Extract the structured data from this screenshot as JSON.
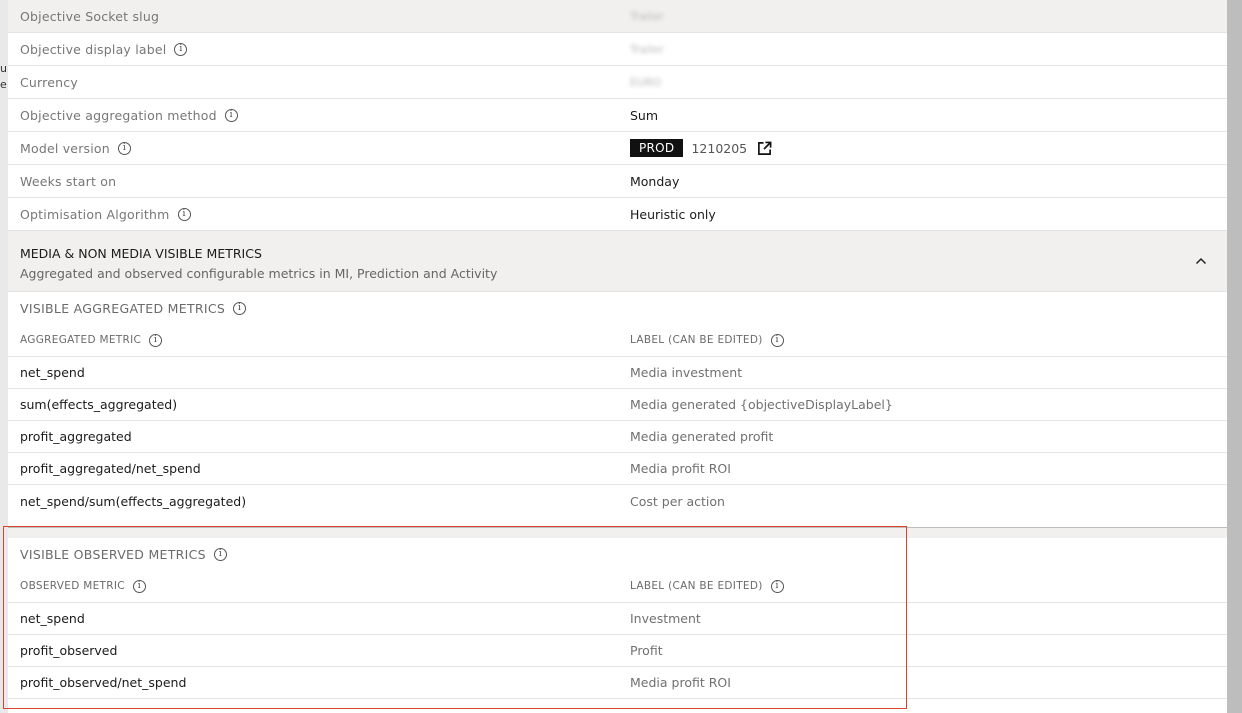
{
  "background_fragments": [
    "u",
    "e"
  ],
  "settings": [
    {
      "label": "Objective Socket slug",
      "info": false,
      "value": "Trailer",
      "blurred": true,
      "grey": true
    },
    {
      "label": "Objective display label",
      "info": true,
      "value": "Trailer",
      "blurred": true,
      "grey": false
    },
    {
      "label": "Currency",
      "info": false,
      "value": "EURO",
      "blurred": true,
      "grey": false
    },
    {
      "label": "Objective aggregation method",
      "info": true,
      "value": "Sum",
      "blurred": false,
      "grey": false
    },
    {
      "label": "Model version",
      "info": true,
      "value": "",
      "blurred": false,
      "grey": false
    },
    {
      "label": "Weeks start on",
      "info": false,
      "value": "Monday",
      "blurred": false,
      "grey": false
    },
    {
      "label": "Optimisation Algorithm",
      "info": true,
      "value": "Heuristic only",
      "blurred": false,
      "grey": false
    }
  ],
  "model_version": {
    "badge": "PROD",
    "number": "1210205",
    "icon": "external-link-icon"
  },
  "section": {
    "title": "MEDIA & NON MEDIA VISIBLE METRICS",
    "subtitle": "Aggregated and observed configurable metrics in MI, Prediction and Activity",
    "toggle_icon": "chevron-up-icon"
  },
  "aggregated": {
    "heading": "VISIBLE AGGREGATED METRICS",
    "col_metric": "AGGREGATED METRIC",
    "col_label": "LABEL (CAN BE EDITED)",
    "rows": [
      {
        "metric": "net_spend",
        "label": "Media investment"
      },
      {
        "metric": "sum(effects_aggregated)",
        "label": "Media generated {objectiveDisplayLabel}"
      },
      {
        "metric": "profit_aggregated",
        "label": "Media generated profit"
      },
      {
        "metric": "profit_aggregated/net_spend",
        "label": "Media profit ROI"
      },
      {
        "metric": "net_spend/sum(effects_aggregated)",
        "label": "Cost per action"
      }
    ]
  },
  "observed": {
    "heading": "VISIBLE OBSERVED METRICS",
    "col_metric": "OBSERVED METRIC",
    "col_label": "LABEL (CAN BE EDITED)",
    "rows": [
      {
        "metric": "net_spend",
        "label": "Investment"
      },
      {
        "metric": "profit_observed",
        "label": "Profit"
      },
      {
        "metric": "profit_observed/net_spend",
        "label": "Media profit ROI"
      }
    ]
  },
  "colors": {
    "highlight": "#d9442b",
    "badge": "#111111",
    "header_bg": "#f1f0ee"
  }
}
